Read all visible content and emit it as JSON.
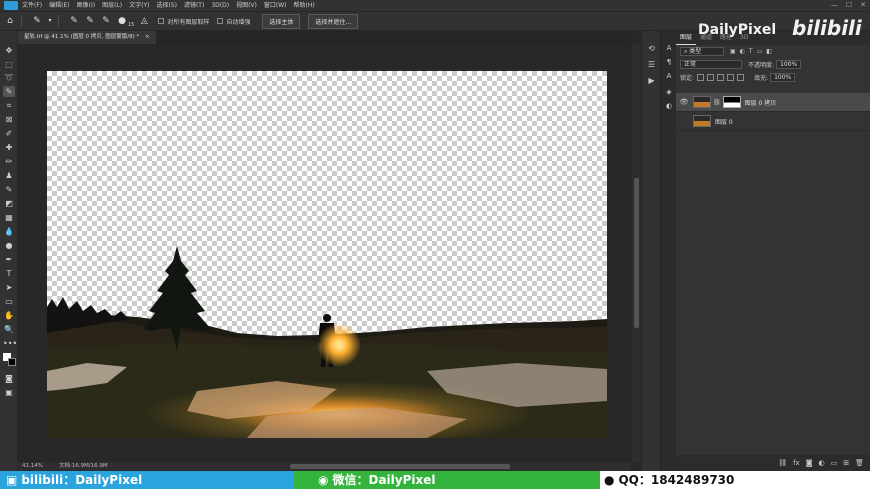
{
  "menu": {
    "items": [
      "文件(F)",
      "编辑(E)",
      "图像(I)",
      "图层(L)",
      "文字(Y)",
      "选择(S)",
      "滤镜(T)",
      "3D(D)",
      "视图(V)",
      "窗口(W)",
      "帮助(H)"
    ]
  },
  "options": {
    "size_value": "15",
    "sample_all_label": "对所有图层取样",
    "auto_enhance_label": "自动增强",
    "select_subject_label": "选择主体",
    "select_mask_label": "选择并遮住..."
  },
  "document": {
    "tab_title": "星轨.tif @ 41.1% (图层 0 拷贝, 图层蒙版/8) *",
    "zoom": "41.14%",
    "doc_size": "文档:16.9M/16.9M"
  },
  "panel": {
    "tabs": [
      "图层",
      "通道",
      "路径",
      "3D"
    ],
    "filter_kind": "类型",
    "blend_mode": "正常",
    "opacity_label": "不透明度:",
    "opacity_value": "100%",
    "lock_label": "锁定:",
    "fill_label": "填充:",
    "fill_value": "100%",
    "layers": [
      {
        "name": "图层 0 拷贝",
        "selected": true,
        "visible": true
      },
      {
        "name": "图层 0",
        "selected": false,
        "visible": false
      }
    ]
  },
  "brand": {
    "name": "DailyPixel",
    "logo_text": "bilibili"
  },
  "banner": {
    "bili": "bilibili：DailyPixel",
    "wechat": "微信：DailyPixel",
    "qq": "QQ：1842489730"
  },
  "colors": {
    "accent_blue": "#2aa4de",
    "accent_green": "#34b43c",
    "lantern": "#f0a030"
  },
  "icons": {
    "window_controls": [
      "—",
      "☐",
      "✕"
    ]
  }
}
